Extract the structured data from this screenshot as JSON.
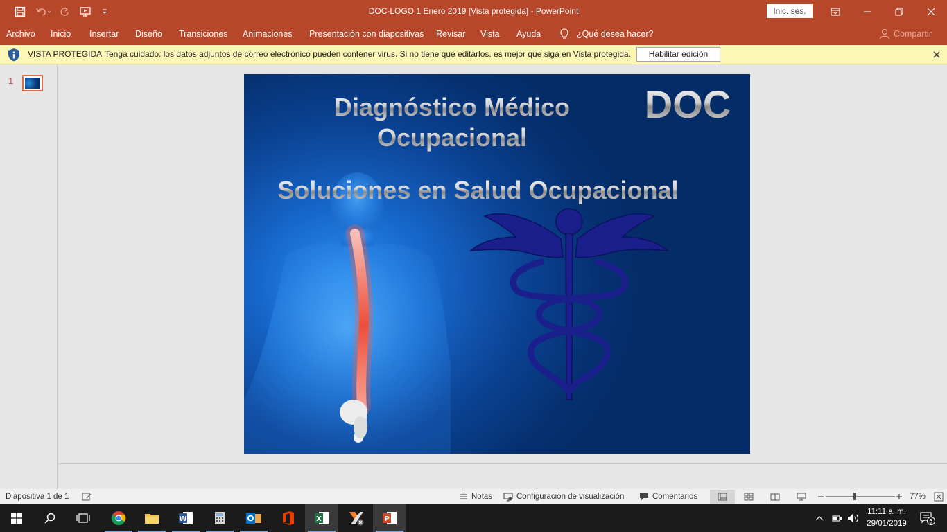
{
  "window": {
    "title": "DOC-LOGO 1 Enero 2019  [Vista protegida]  -  PowerPoint",
    "signin_label": "Inic. ses."
  },
  "ribbon": {
    "tabs": [
      "Archivo",
      "Inicio",
      "Insertar",
      "Diseño",
      "Transiciones",
      "Animaciones",
      "Presentación con diapositivas",
      "Revisar",
      "Vista",
      "Ayuda"
    ],
    "tell_me": "¿Qué desea hacer?",
    "share": "Compartir"
  },
  "protected_view": {
    "title": "VISTA PROTEGIDA",
    "message": "Tenga cuidado: los datos adjuntos de correo electrónico pueden contener virus. Si no tiene que editarlos, es mejor que siga en Vista protegida.",
    "enable_button": "Habilitar edición"
  },
  "thumbnails": {
    "items": [
      {
        "number": "1"
      }
    ]
  },
  "slide": {
    "title_line1": "Diagnóstico Médico",
    "title_line2": "Ocupacional",
    "brand": "DOC",
    "subtitle": "Soluciones en Salud Ocupacional"
  },
  "status": {
    "slide_info": "Diapositiva 1 de 1",
    "notes": "Notas",
    "display_settings": "Configuración de visualización",
    "comments": "Comentarios",
    "zoom": "77%",
    "zoom_level": 0.42
  },
  "taskbar": {
    "time": "11:11 a. m.",
    "date": "29/01/2019",
    "notification_count": "5"
  },
  "colors": {
    "accent": "#b7472a",
    "pv_bar": "#fcf7b6",
    "caduceus": "#1a1f8c",
    "taskbar": "#1b1b1b"
  }
}
